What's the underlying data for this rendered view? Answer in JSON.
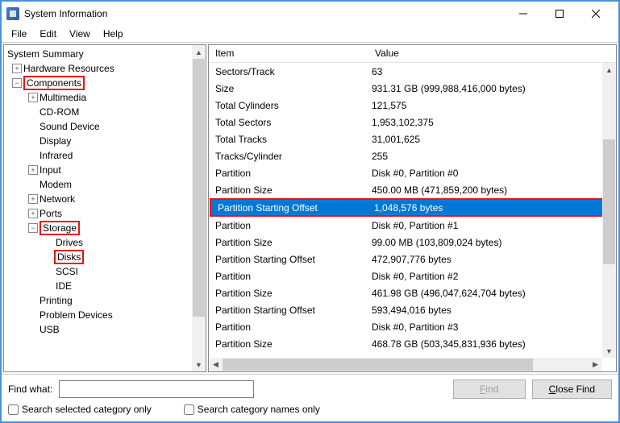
{
  "window": {
    "title": "System Information"
  },
  "menu": {
    "file": "File",
    "edit": "Edit",
    "view": "View",
    "help": "Help"
  },
  "tree": {
    "summary": "System Summary",
    "hardware": "Hardware Resources",
    "components": "Components",
    "multimedia": "Multimedia",
    "cdrom": "CD-ROM",
    "sound": "Sound Device",
    "display": "Display",
    "infrared": "Infrared",
    "input": "Input",
    "modem": "Modem",
    "network": "Network",
    "ports": "Ports",
    "storage": "Storage",
    "drives": "Drives",
    "disks": "Disks",
    "scsi": "SCSI",
    "ide": "IDE",
    "printing": "Printing",
    "problem": "Problem Devices",
    "usb": "USB"
  },
  "list": {
    "col_item": "Item",
    "col_value": "Value",
    "rows": [
      {
        "item": "Sectors/Track",
        "value": "63"
      },
      {
        "item": "Size",
        "value": "931.31 GB (999,988,416,000 bytes)"
      },
      {
        "item": "Total Cylinders",
        "value": "121,575"
      },
      {
        "item": "Total Sectors",
        "value": "1,953,102,375"
      },
      {
        "item": "Total Tracks",
        "value": "31,001,625"
      },
      {
        "item": "Tracks/Cylinder",
        "value": "255"
      },
      {
        "item": "Partition",
        "value": "Disk #0, Partition #0"
      },
      {
        "item": "Partition Size",
        "value": "450.00 MB (471,859,200 bytes)"
      },
      {
        "item": "Partition Starting Offset",
        "value": "1,048,576 bytes",
        "selected": true
      },
      {
        "item": "Partition",
        "value": "Disk #0, Partition #1"
      },
      {
        "item": "Partition Size",
        "value": "99.00 MB (103,809,024 bytes)"
      },
      {
        "item": "Partition Starting Offset",
        "value": "472,907,776 bytes"
      },
      {
        "item": "Partition",
        "value": "Disk #0, Partition #2"
      },
      {
        "item": "Partition Size",
        "value": "461.98 GB (496,047,624,704 bytes)"
      },
      {
        "item": "Partition Starting Offset",
        "value": "593,494,016 bytes"
      },
      {
        "item": "Partition",
        "value": "Disk #0, Partition #3"
      },
      {
        "item": "Partition Size",
        "value": "468.78 GB (503,345,831,936 bytes)"
      }
    ]
  },
  "find": {
    "label": "Find what:",
    "find_btn": "Find",
    "close_btn": "Close Find",
    "check1": "Search selected category only",
    "check2": "Search category names only"
  }
}
